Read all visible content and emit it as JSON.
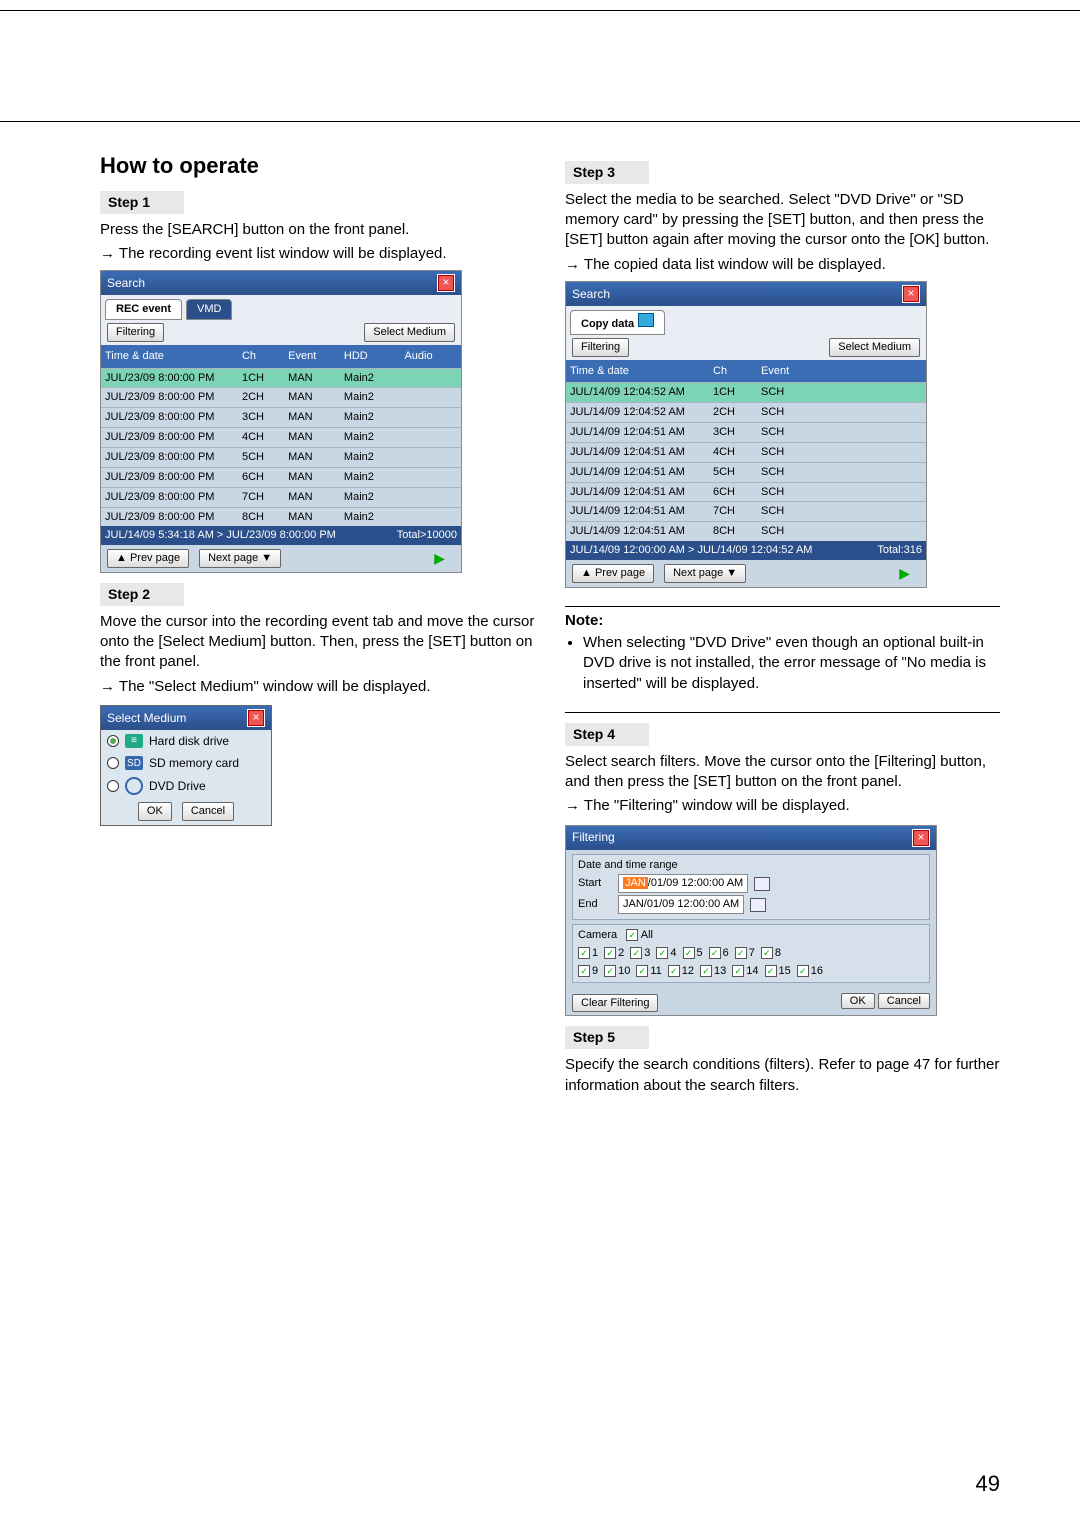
{
  "page_number": "49",
  "heading": "How to operate",
  "steps": {
    "s1": {
      "label": "Step 1",
      "text": "Press the [SEARCH] button on the front panel.",
      "result": "The recording event list window will be displayed."
    },
    "s2": {
      "label": "Step 2",
      "text": "Move the cursor into the recording event tab and move the cursor onto the [Select Medium] button. Then, press the [SET] button on the front panel.",
      "result": "The \"Select Medium\" window will be displayed."
    },
    "s3": {
      "label": "Step 3",
      "text": "Select the media to be searched. Select \"DVD Drive\" or \"SD memory card\" by pressing the [SET] button, and then press the [SET] button again after moving the cursor onto the [OK] button.",
      "result": "The copied data list window will be displayed."
    },
    "s4": {
      "label": "Step 4",
      "text": "Select search filters. Move the cursor onto the [Filtering] button, and then press the [SET] button on the front panel.",
      "result": "The \"Filtering\" window will be displayed."
    },
    "s5": {
      "label": "Step 5",
      "text": "Specify the search conditions (filters). Refer to page 47 for further information about the search filters."
    }
  },
  "note": {
    "title": "Note:",
    "body": "When selecting \"DVD Drive\" even though an optional built-in DVD drive is not installed, the error message of \"No media is inserted\" will be displayed."
  },
  "win1": {
    "title": "Search",
    "tab_rec": "REC event",
    "tab_vmd": "VMD",
    "filtering": "Filtering",
    "select_medium": "Select Medium",
    "hdr_timedate": "Time & date",
    "hdr_ch": "Ch",
    "hdr_event": "Event",
    "hdr_hdd": "HDD",
    "hdr_audio": "Audio",
    "rows": [
      {
        "td": "JUL/23/09  8:00:00 PM",
        "ch": "1CH",
        "ev": "MAN",
        "hd": "Main2",
        "au": ""
      },
      {
        "td": "JUL/23/09  8:00:00 PM",
        "ch": "2CH",
        "ev": "MAN",
        "hd": "Main2",
        "au": ""
      },
      {
        "td": "JUL/23/09  8:00:00 PM",
        "ch": "3CH",
        "ev": "MAN",
        "hd": "Main2",
        "au": ""
      },
      {
        "td": "JUL/23/09  8:00:00 PM",
        "ch": "4CH",
        "ev": "MAN",
        "hd": "Main2",
        "au": ""
      },
      {
        "td": "JUL/23/09  8:00:00 PM",
        "ch": "5CH",
        "ev": "MAN",
        "hd": "Main2",
        "au": ""
      },
      {
        "td": "JUL/23/09  8:00:00 PM",
        "ch": "6CH",
        "ev": "MAN",
        "hd": "Main2",
        "au": ""
      },
      {
        "td": "JUL/23/09  8:00:00 PM",
        "ch": "7CH",
        "ev": "MAN",
        "hd": "Main2",
        "au": ""
      },
      {
        "td": "JUL/23/09  8:00:00 PM",
        "ch": "8CH",
        "ev": "MAN",
        "hd": "Main2",
        "au": ""
      }
    ],
    "status_left": "JUL/14/09  5:34:18 AM > JUL/23/09  8:00:00 PM",
    "status_right": "Total>10000",
    "prev": "▲ Prev page",
    "next": "Next page ▼"
  },
  "medium": {
    "title": "Select Medium",
    "hdd": "Hard disk drive",
    "sd": "SD memory card",
    "dvd": "DVD Drive",
    "ok": "OK",
    "cancel": "Cancel"
  },
  "win2": {
    "title": "Search",
    "tab_copy": "Copy data",
    "filtering": "Filtering",
    "select_medium": "Select Medium",
    "hdr_timedate": "Time & date",
    "hdr_ch": "Ch",
    "hdr_event": "Event",
    "rows": [
      {
        "td": "JUL/14/09 12:04:52 AM",
        "ch": "1CH",
        "ev": "SCH"
      },
      {
        "td": "JUL/14/09 12:04:52 AM",
        "ch": "2CH",
        "ev": "SCH"
      },
      {
        "td": "JUL/14/09 12:04:51 AM",
        "ch": "3CH",
        "ev": "SCH"
      },
      {
        "td": "JUL/14/09 12:04:51 AM",
        "ch": "4CH",
        "ev": "SCH"
      },
      {
        "td": "JUL/14/09 12:04:51 AM",
        "ch": "5CH",
        "ev": "SCH"
      },
      {
        "td": "JUL/14/09 12:04:51 AM",
        "ch": "6CH",
        "ev": "SCH"
      },
      {
        "td": "JUL/14/09 12:04:51 AM",
        "ch": "7CH",
        "ev": "SCH"
      },
      {
        "td": "JUL/14/09 12:04:51 AM",
        "ch": "8CH",
        "ev": "SCH"
      }
    ],
    "status_left": "JUL/14/09 12:00:00 AM > JUL/14/09 12:04:52 AM",
    "status_right": "Total:316",
    "prev": "▲ Prev page",
    "next": "Next page ▼"
  },
  "filt": {
    "title": "Filtering",
    "range_label": "Date and time range",
    "start_label": "Start",
    "start_hl": "JAN",
    "start_rest": "/01/09 12:00:00 AM",
    "end_label": "End",
    "end_val": "JAN/01/09 12:00:00 AM",
    "camera_label": "Camera",
    "all_label": "All",
    "cams_a": [
      "1",
      "2",
      "3",
      "4",
      "5",
      "6",
      "7",
      "8"
    ],
    "cams_b": [
      "9",
      "10",
      "11",
      "12",
      "13",
      "14",
      "15",
      "16"
    ],
    "clear": "Clear Filtering",
    "ok": "OK",
    "cancel": "Cancel"
  }
}
